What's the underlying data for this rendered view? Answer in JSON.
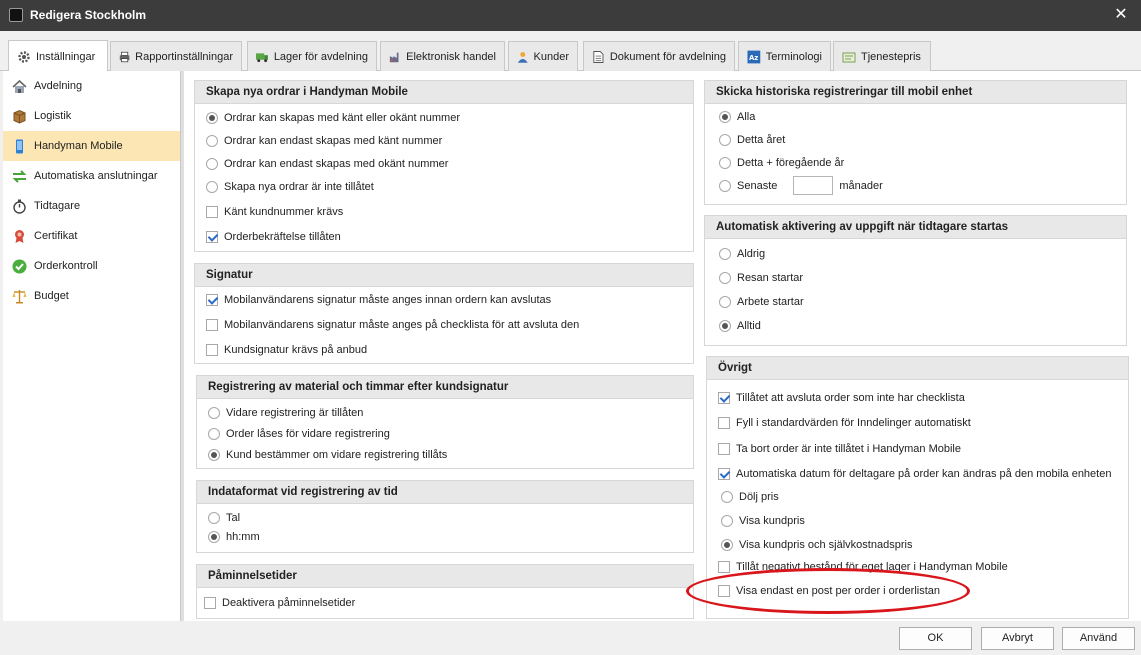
{
  "window": {
    "title": "Redigera Stockholm",
    "close_symbol": "✕"
  },
  "tabs": [
    {
      "label": "Inställningar",
      "icon": "gear-icon"
    },
    {
      "label": "Rapportinställningar",
      "icon": "printer-icon"
    },
    {
      "label": "Lager för avdelning",
      "icon": "truck-icon"
    },
    {
      "label": "Elektronisk handel",
      "icon": "factory-icon"
    },
    {
      "label": "Kunder",
      "icon": "person-icon"
    },
    {
      "label": "Dokument för avdelning",
      "icon": "document-icon"
    },
    {
      "label": "Terminologi",
      "icon": "terminology-icon"
    },
    {
      "label": "Tjenestepris",
      "icon": "price-tag-icon"
    }
  ],
  "sidebar": {
    "items": [
      {
        "label": "Avdelning",
        "icon": "house-icon"
      },
      {
        "label": "Logistik",
        "icon": "box-icon"
      },
      {
        "label": "Handyman Mobile",
        "icon": "phone-icon"
      },
      {
        "label": "Automatiska anslutningar",
        "icon": "arrows-icon"
      },
      {
        "label": "Tidtagare",
        "icon": "stopwatch-icon"
      },
      {
        "label": "Certifikat",
        "icon": "award-icon"
      },
      {
        "label": "Orderkontroll",
        "icon": "check-circle-icon"
      },
      {
        "label": "Budget",
        "icon": "scales-icon"
      }
    ]
  },
  "panels": {
    "new_orders": {
      "title": "Skapa nya ordrar i Handyman Mobile",
      "radios": [
        {
          "label": "Ordrar kan skapas med känt eller okänt nummer",
          "checked": true
        },
        {
          "label": "Ordrar kan endast skapas med känt nummer",
          "checked": false
        },
        {
          "label": "Ordrar kan endast skapas med okänt nummer",
          "checked": false
        },
        {
          "label": "Skapa nya ordrar är inte tillåtet",
          "checked": false
        }
      ],
      "checkboxes": [
        {
          "label": "Känt kundnummer krävs",
          "checked": false
        },
        {
          "label": "Orderbekräftelse tillåten",
          "checked": true
        }
      ]
    },
    "signature": {
      "title": "Signatur",
      "checkboxes": [
        {
          "label": "Mobilanvändarens signatur måste anges innan ordern kan avslutas",
          "checked": true
        },
        {
          "label": "Mobilanvändarens signatur måste anges på checklista för att avsluta den",
          "checked": false
        },
        {
          "label": "Kundsignatur krävs på anbud",
          "checked": false
        }
      ]
    },
    "registration": {
      "title": "Registrering av material och timmar efter kundsignatur",
      "radios": [
        {
          "label": "Vidare registrering är tillåten",
          "checked": false
        },
        {
          "label": "Order låses för vidare registrering",
          "checked": false
        },
        {
          "label": "Kund bestämmer om vidare registrering tillåts",
          "checked": true
        }
      ]
    },
    "input_format": {
      "title": "Indataformat vid registrering av tid",
      "radios": [
        {
          "label": "Tal",
          "checked": false
        },
        {
          "label": "hh:mm",
          "checked": true
        }
      ]
    },
    "reminders": {
      "title": "Påminnelsetider",
      "checkboxes": [
        {
          "label": "Deaktivera påminnelsetider",
          "checked": false
        }
      ]
    },
    "history": {
      "title": "Skicka historiska registreringar till mobil enhet",
      "radios": [
        {
          "label": "Alla",
          "checked": true
        },
        {
          "label": "Detta året",
          "checked": false
        },
        {
          "label": "Detta + föregående år",
          "checked": false
        },
        {
          "label": "Senaste",
          "checked": false
        }
      ],
      "months_value": "",
      "months_label": "månader"
    },
    "auto_activation": {
      "title": "Automatisk aktivering av uppgift när tidtagare startas",
      "radios": [
        {
          "label": "Aldrig",
          "checked": false
        },
        {
          "label": "Resan startar",
          "checked": false
        },
        {
          "label": "Arbete startar",
          "checked": false
        },
        {
          "label": "Alltid",
          "checked": true
        }
      ]
    },
    "other": {
      "title": "Övrigt",
      "items": [
        {
          "type": "check",
          "label": "Tillåtet att avsluta order som inte har checklista",
          "checked": true
        },
        {
          "type": "check",
          "label": "Fyll i standardvärden för Inndelinger automatiskt",
          "checked": false
        },
        {
          "type": "check",
          "label": "Ta bort order är inte tillåtet i Handyman Mobile",
          "checked": false
        },
        {
          "type": "check",
          "label": "Automatiska datum för deltagare på order kan ändras på den mobila enheten",
          "checked": true
        },
        {
          "type": "radio",
          "label": "Dölj pris",
          "checked": false
        },
        {
          "type": "radio",
          "label": "Visa kundpris",
          "checked": false
        },
        {
          "type": "radio",
          "label": "Visa kundpris och självkostnadspris",
          "checked": true
        },
        {
          "type": "check",
          "label": "Tillåt negativt bestånd för eget lager i Handyman Mobile",
          "checked": false
        },
        {
          "type": "check",
          "label": "Visa endast en post per order i orderlistan",
          "checked": false
        }
      ]
    }
  },
  "buttons": {
    "ok": "OK",
    "cancel": "Avbryt",
    "apply": "Använd"
  },
  "colors": {
    "titlebar": "#3c3c3c",
    "active_sidebar": "#fce7b4",
    "highlight_ellipse": "#d9161c",
    "check_mark": "#2a6ac8"
  }
}
